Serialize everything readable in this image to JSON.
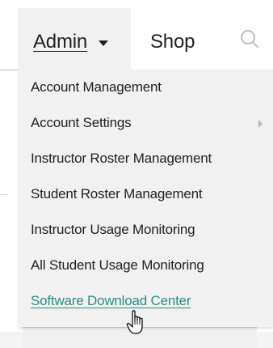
{
  "nav": {
    "admin_label": "Admin",
    "shop_label": "Shop",
    "search_icon": "search-icon",
    "caret_icon": "caret-down-icon"
  },
  "admin_menu": {
    "items": [
      {
        "label": "Account Management",
        "has_submenu": false,
        "is_link": false
      },
      {
        "label": "Account Settings",
        "has_submenu": true,
        "is_link": false
      },
      {
        "label": "Instructor Roster Management",
        "has_submenu": false,
        "is_link": false
      },
      {
        "label": "Student Roster Management",
        "has_submenu": false,
        "is_link": false
      },
      {
        "label": "Instructor Usage Monitoring",
        "has_submenu": false,
        "is_link": false
      },
      {
        "label": "All Student Usage Monitoring",
        "has_submenu": false,
        "is_link": false
      },
      {
        "label": "Software Download Center",
        "has_submenu": false,
        "is_link": true
      }
    ]
  },
  "cursor": {
    "icon": "hand-pointer-icon"
  },
  "colors": {
    "menu_background": "#f1f1f1",
    "link_color": "#2a8f80",
    "text_color": "#222222"
  }
}
